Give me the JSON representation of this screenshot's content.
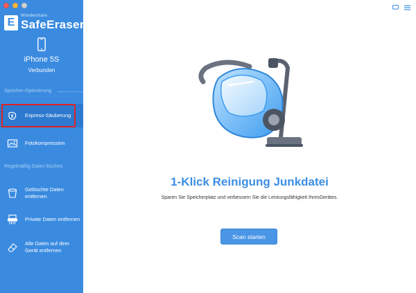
{
  "sidebar": {
    "brand_small": "Wondershare",
    "brand_name": "SafeEraser",
    "brand_logo_letter": "E",
    "device_icon": "iphone-icon",
    "device_name": "iPhone 5S",
    "device_status": "Verbunden",
    "section_storage": "Speicher-Optimierung",
    "section_privacy": "Regelmäßig Daten löschen",
    "items": [
      {
        "label": "Express-Säuberung",
        "icon": "express-clean-icon",
        "active": true
      },
      {
        "label": "Fotokompression",
        "icon": "photo-icon",
        "active": false
      },
      {
        "label": "Gelöschte Daten entfernen",
        "icon": "trash-icon",
        "active": false
      },
      {
        "label": "Private Daten entfernen",
        "icon": "shredder-icon",
        "active": false
      },
      {
        "label": "Alle Daten auf dem Gerät entfernen",
        "icon": "eraser-icon",
        "active": false
      }
    ]
  },
  "main": {
    "hero_icon": "vacuum-cleaner-icon",
    "title": "1-Klick Reinigung Junkdatei",
    "subtitle": "Sparen Sie Speicherplatz und verbessern Sie die Leistungsfähigkeit IhresGerätes.",
    "scan_button": "Scan starten"
  },
  "colors": {
    "sidebar_bg": "#3a8be0",
    "accent": "#3b8ee3",
    "highlight": "#e02222"
  }
}
